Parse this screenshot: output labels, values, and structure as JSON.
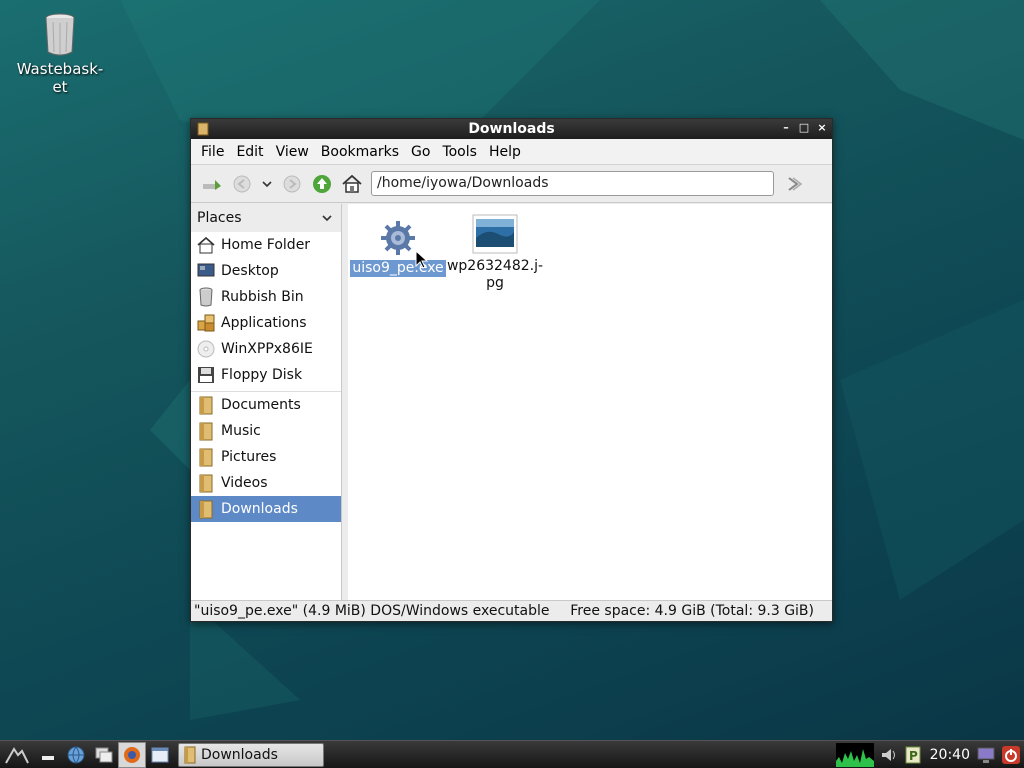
{
  "desktop": {
    "wastebasket_label": "Wastebask-\net"
  },
  "window": {
    "title": "Downloads",
    "controls": {
      "minimize": "–",
      "maximize": "□",
      "close": "×"
    }
  },
  "menubar": {
    "items": [
      "File",
      "Edit",
      "View",
      "Bookmarks",
      "Go",
      "Tools",
      "Help"
    ]
  },
  "toolbar": {
    "address": "/home/iyowa/Downloads"
  },
  "sidebar": {
    "header": "Places",
    "places": [
      {
        "label": "Home Folder",
        "icon": "home-icon"
      },
      {
        "label": "Desktop",
        "icon": "desktop-icon"
      },
      {
        "label": "Rubbish Bin",
        "icon": "trash-icon"
      },
      {
        "label": "Applications",
        "icon": "applications-icon"
      },
      {
        "label": "WinXPPx86IE",
        "icon": "cd-drive-icon"
      },
      {
        "label": "Floppy Disk",
        "icon": "floppy-icon"
      }
    ],
    "bookmarks": [
      {
        "label": "Documents",
        "icon": "folder-icon"
      },
      {
        "label": "Music",
        "icon": "folder-icon"
      },
      {
        "label": "Pictures",
        "icon": "folder-icon"
      },
      {
        "label": "Videos",
        "icon": "folder-icon"
      },
      {
        "label": "Downloads",
        "icon": "folder-icon",
        "selected": true
      }
    ]
  },
  "files": [
    {
      "name": "uiso9_pe.exe",
      "icon": "executable-gear-icon",
      "selected": true
    },
    {
      "name": "wp2632482.j-\npg",
      "icon": "image-file-icon",
      "selected": false
    }
  ],
  "statusbar": {
    "left": "\"uiso9_pe.exe\" (4.9 MiB) DOS/Windows executable",
    "right": "Free space: 4.9 GiB (Total: 9.3 GiB)"
  },
  "taskbar": {
    "task_label": "Downloads",
    "clock": "20:40"
  },
  "colors": {
    "selection": "#5d89c7",
    "titlebar": "#1e1e1e"
  }
}
